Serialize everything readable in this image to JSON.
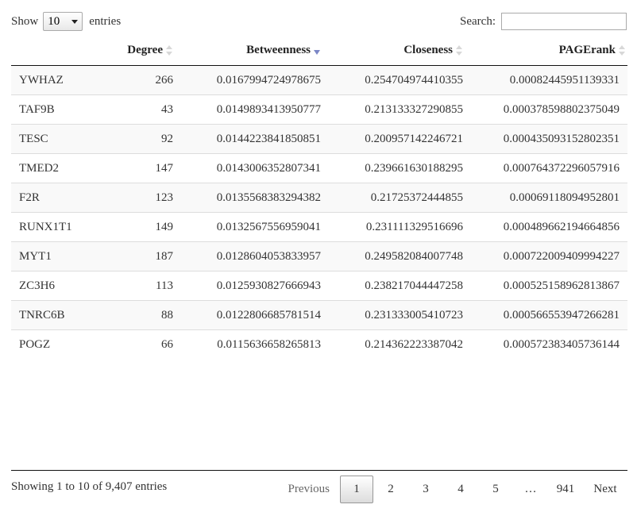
{
  "length": {
    "show_label": "Show",
    "value": "10",
    "entries_label": "entries"
  },
  "search": {
    "label": "Search:",
    "value": ""
  },
  "columns": [
    {
      "label": ""
    },
    {
      "label": "Degree"
    },
    {
      "label": "Betweenness"
    },
    {
      "label": "Closeness"
    },
    {
      "label": "PAGErank"
    }
  ],
  "sorted_column": "Betweenness",
  "sort_direction": "descending",
  "rows": [
    {
      "name": "YWHAZ",
      "degree": "266",
      "betweenness": "0.0167994724978675",
      "closeness": "0.254704974410355",
      "pagerank": "0.00082445951139331"
    },
    {
      "name": "TAF9B",
      "degree": "43",
      "betweenness": "0.0149893413950777",
      "closeness": "0.213133327290855",
      "pagerank": "0.000378598802375049"
    },
    {
      "name": "TESC",
      "degree": "92",
      "betweenness": "0.0144223841850851",
      "closeness": "0.200957142246721",
      "pagerank": "0.000435093152802351"
    },
    {
      "name": "TMED2",
      "degree": "147",
      "betweenness": "0.0143006352807341",
      "closeness": "0.239661630188295",
      "pagerank": "0.000764372296057916"
    },
    {
      "name": "F2R",
      "degree": "123",
      "betweenness": "0.0135568383294382",
      "closeness": "0.21725372444855",
      "pagerank": "0.00069118094952801"
    },
    {
      "name": "RUNX1T1",
      "degree": "149",
      "betweenness": "0.0132567556959041",
      "closeness": "0.231111329516696",
      "pagerank": "0.000489662194664856"
    },
    {
      "name": "MYT1",
      "degree": "187",
      "betweenness": "0.0128604053833957",
      "closeness": "0.249582084007748",
      "pagerank": "0.000722009409994227"
    },
    {
      "name": "ZC3H6",
      "degree": "113",
      "betweenness": "0.0125930827666943",
      "closeness": "0.238217044447258",
      "pagerank": "0.000525158962813867"
    },
    {
      "name": "TNRC6B",
      "degree": "88",
      "betweenness": "0.0122806685781514",
      "closeness": "0.231333005410723",
      "pagerank": "0.000566553947266281"
    },
    {
      "name": "POGZ",
      "degree": "66",
      "betweenness": "0.0115636658265813",
      "closeness": "0.214362223387042",
      "pagerank": "0.000572383405736144"
    }
  ],
  "info": "Showing 1 to 10 of 9,407 entries",
  "pagination": {
    "previous": "Previous",
    "pages": [
      "1",
      "2",
      "3",
      "4",
      "5"
    ],
    "ellipsis": "…",
    "last_page": "941",
    "next": "Next",
    "current": "1"
  },
  "colors": {
    "sort_active": "#7b87c6",
    "sort_inactive": "#d8d8d8",
    "row_stripe": "#f9f9f9"
  }
}
